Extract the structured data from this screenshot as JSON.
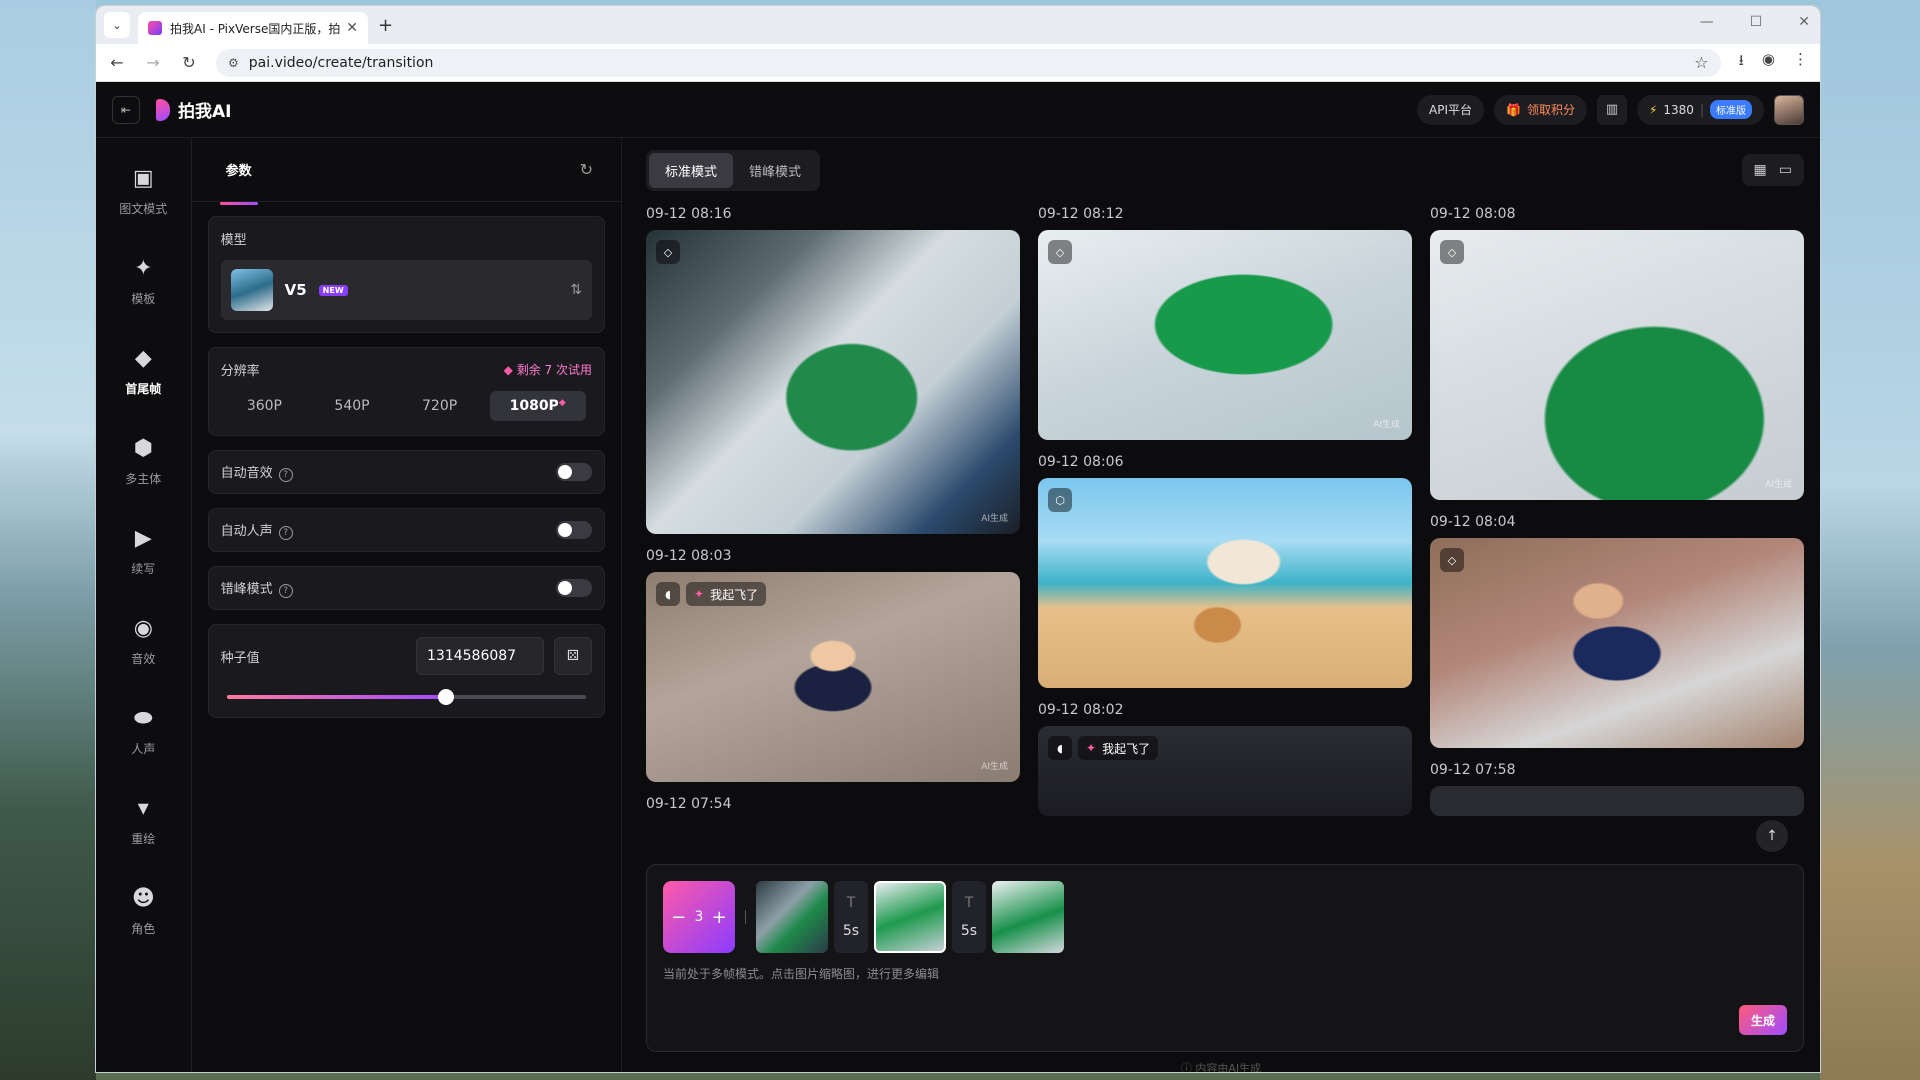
{
  "browser": {
    "tab_title": "拍我AI - PixVerse国内正版，拍",
    "url": "pai.video/create/transition"
  },
  "header": {
    "logo_text": "拍我AI",
    "api_label": "API平台",
    "points_label": "领取积分",
    "credits": "1380",
    "plan_badge": "标准版"
  },
  "leftnav": [
    {
      "label": "图文模式",
      "icon": "image-icon"
    },
    {
      "label": "模板",
      "icon": "sparkle-icon"
    },
    {
      "label": "首尾帧",
      "icon": "diamond-icon"
    },
    {
      "label": "多主体",
      "icon": "cube-icon"
    },
    {
      "label": "续写",
      "icon": "video-extend-icon"
    },
    {
      "label": "音效",
      "icon": "audio-wave-icon"
    },
    {
      "label": "人声",
      "icon": "lips-icon"
    },
    {
      "label": "重绘",
      "icon": "brush-icon"
    },
    {
      "label": "角色",
      "icon": "face-icon"
    }
  ],
  "params": {
    "tab_label": "参数",
    "model_label": "模型",
    "model_name": "V5",
    "new_badge": "NEW",
    "resolution_label": "分辨率",
    "trial_text": "剩余 7 次试用",
    "resolutions": [
      "360P",
      "540P",
      "720P",
      "1080P"
    ],
    "auto_sfx_label": "自动音效",
    "auto_voice_label": "自动人声",
    "offpeak_label": "错峰模式",
    "seed_label": "种子值",
    "seed_value": "1314586087",
    "seed_slider_fraction": 0.61
  },
  "main": {
    "mode_standard": "标准模式",
    "mode_offpeak": "错峰模式",
    "timestamps": {
      "c1a": "09-12 08:16",
      "c1b": "09-12 08:03",
      "c1c": "09-12 07:54",
      "c2a": "09-12 08:12",
      "c2b": "09-12 08:06",
      "c2c": "09-12 08:02",
      "c3a": "09-12 08:08",
      "c3b": "09-12 08:04",
      "c3c": "09-12 07:58"
    },
    "sound_tag": "我起飞了",
    "ai_mark": "AI生成"
  },
  "prompt": {
    "frame_count": "3",
    "duration1": "5s",
    "duration2": "5s",
    "text_icon": "T",
    "hint": "当前处于多帧模式。点击图片缩略图，进行更多编辑",
    "generate_label": "生成"
  },
  "footer": "ⓘ 内容由AI生成"
}
